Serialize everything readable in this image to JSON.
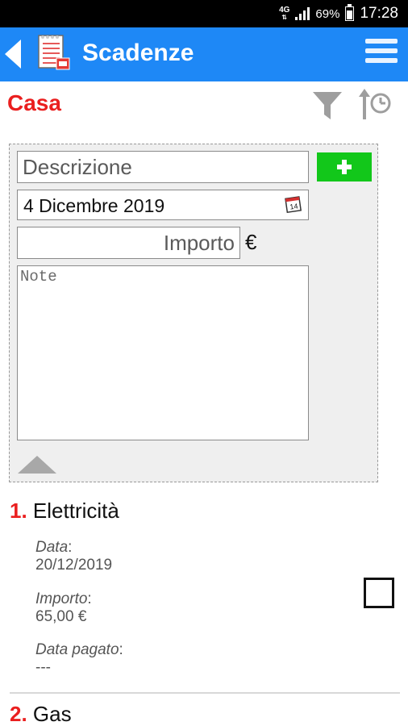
{
  "status_bar": {
    "network": "4G",
    "battery_percent": "69%",
    "battery_level": 0.69,
    "time": "17:28"
  },
  "app_bar": {
    "title": "Scadenze",
    "back_icon": "back-arrow-icon",
    "logo_icon": "document-list-icon",
    "menu_icon": "hamburger-menu-icon",
    "color": "#1e88f6"
  },
  "section": {
    "title": "Casa",
    "title_color": "#ea1f1f",
    "filter_icon": "filter-icon",
    "sort_icon": "sort-by-time-icon"
  },
  "form": {
    "description_placeholder": "Descrizione",
    "add_button_icon": "plus-icon",
    "add_button_color": "#12c71a",
    "date_value": "4 Dicembre 2019",
    "calendar_icon": "calendar-icon",
    "amount_placeholder": "Importo",
    "currency_symbol": "€",
    "notes_placeholder": "Note",
    "collapse_icon": "triangle-up-icon"
  },
  "items": [
    {
      "number": "1.",
      "name": "Elettricità",
      "date_label": "Data",
      "date_value": "20/12/2019",
      "amount_label": "Importo",
      "amount_value": "65,00 €",
      "paid_label": "Data pagato",
      "paid_value": "---",
      "checked": false
    },
    {
      "number": "2.",
      "name": "Gas"
    }
  ]
}
